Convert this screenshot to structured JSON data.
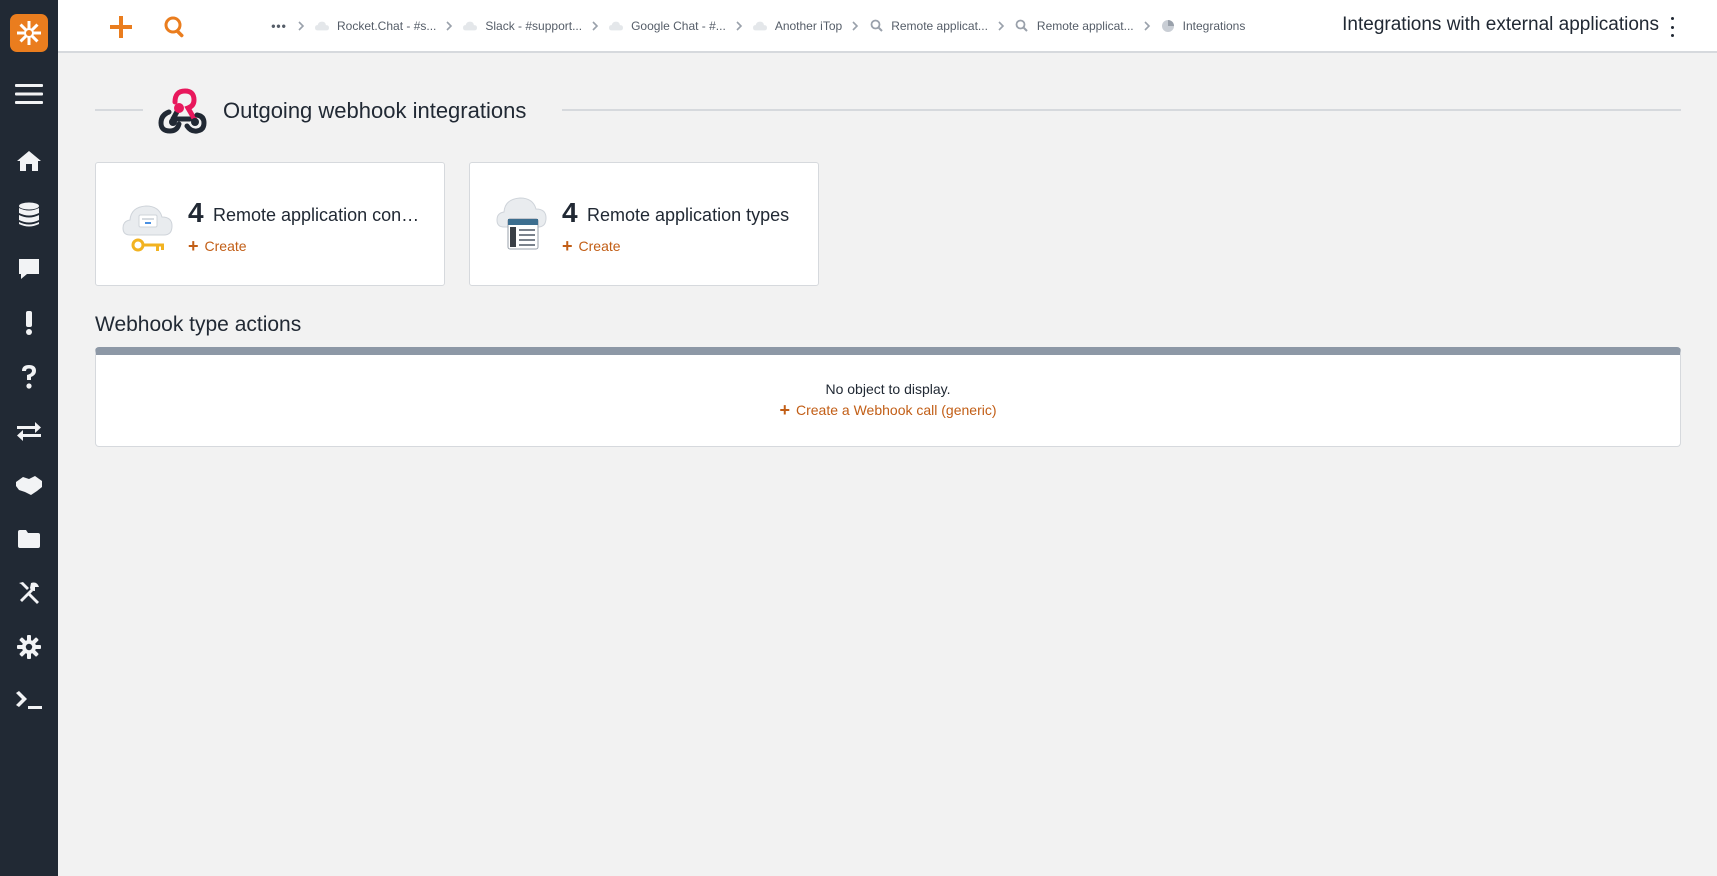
{
  "topbar": {
    "breadcrumbs": [
      {
        "label": "Rocket.Chat - #s...",
        "icon": "cloud-icon"
      },
      {
        "label": "Slack - #support...",
        "icon": "cloud-icon"
      },
      {
        "label": "Google Chat - #...",
        "icon": "cloud-icon"
      },
      {
        "label": "Another iTop",
        "icon": "cloud-icon"
      },
      {
        "label": "Remote applicat...",
        "icon": "search-icon"
      },
      {
        "label": "Remote applicat...",
        "icon": "search-icon"
      },
      {
        "label": "Integrations",
        "icon": "pie-chart-icon"
      }
    ],
    "page_title": "Integrations with external applications"
  },
  "sidebar": {
    "items": [
      {
        "icon": "menu-icon"
      },
      {
        "icon": "home-icon"
      },
      {
        "icon": "database-icon"
      },
      {
        "icon": "comment-icon"
      },
      {
        "icon": "exclamation-icon"
      },
      {
        "icon": "question-icon"
      },
      {
        "icon": "exchange-icon"
      },
      {
        "icon": "handshake-icon"
      },
      {
        "icon": "folder-icon"
      },
      {
        "icon": "tools-icon"
      },
      {
        "icon": "gear-icon"
      },
      {
        "icon": "terminal-icon"
      }
    ]
  },
  "section": {
    "title": "Outgoing webhook integrations"
  },
  "cards": [
    {
      "count": "4",
      "label": "Remote application connections",
      "create_label": "Create",
      "icon": "cloud-key-icon"
    },
    {
      "count": "4",
      "label": "Remote application types",
      "create_label": "Create",
      "icon": "cloud-server-icon"
    }
  ],
  "webhook_actions": {
    "title": "Webhook type actions",
    "empty_text": "No object to display.",
    "create_label": "Create a Webhook call (generic)"
  },
  "colors": {
    "sidebar_bg": "#212934",
    "accent": "#ea7d1e",
    "link": "#c25e16",
    "page_bg": "#f2f2f2"
  }
}
